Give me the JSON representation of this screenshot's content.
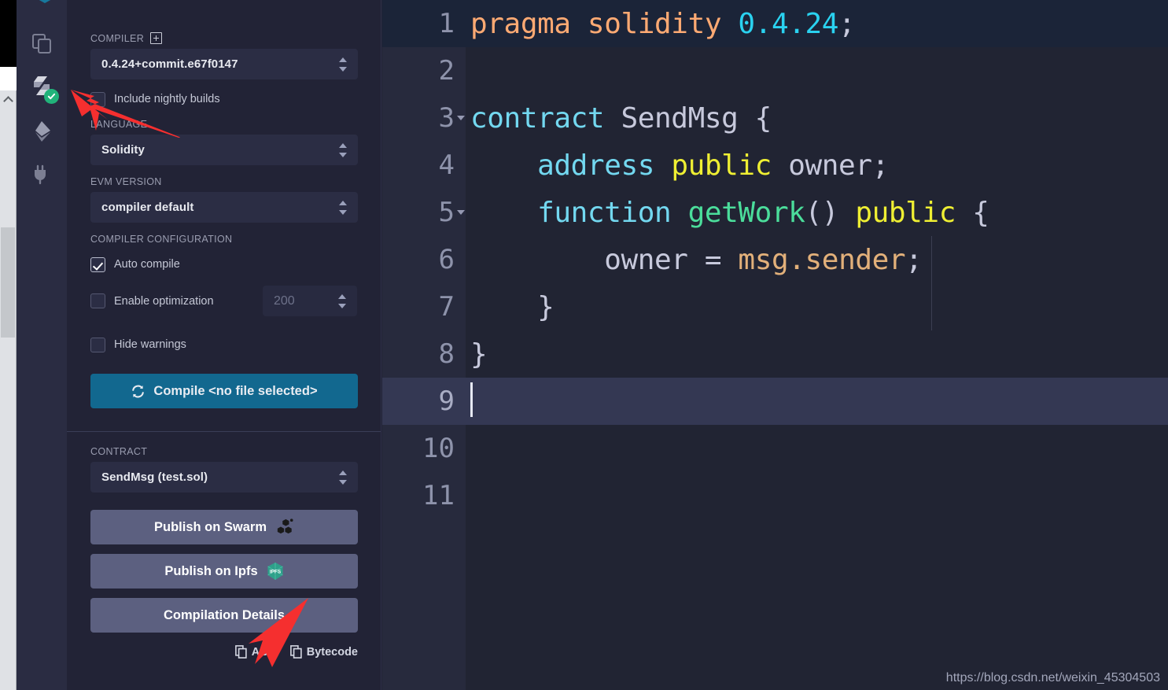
{
  "colors": {
    "panel_bg": "#222336",
    "rail_bg": "#2a2c42",
    "editor_bg": "#212433",
    "gutter_bg": "#272a3d",
    "accent_compile": "#12688f",
    "publish_btn": "#5c6080",
    "badge_green": "#21b37a",
    "annotation_red": "#f52f2f",
    "active_line": "#343853"
  },
  "rail": {
    "logo_name": "remix-logo",
    "items": [
      {
        "name": "file-explorers-icon",
        "label": "File explorers"
      },
      {
        "name": "solidity-compiler-icon",
        "label": "Solidity compiler",
        "badge": "check"
      },
      {
        "name": "deploy-run-icon",
        "label": "Deploy and run transactions"
      },
      {
        "name": "plugin-manager-icon",
        "label": "Plugin manager"
      }
    ]
  },
  "panel": {
    "compiler_label": "COMPILER",
    "compiler_add_icon": "plus-box-icon",
    "compiler_version": "0.4.24+commit.e67f0147",
    "nightly_checkbox": {
      "label": "Include nightly builds",
      "checked": false
    },
    "language_label": "LANGUAGE",
    "language_value": "Solidity",
    "evm_label": "EVM VERSION",
    "evm_value": "compiler default",
    "config_label": "COMPILER CONFIGURATION",
    "auto_compile": {
      "label": "Auto compile",
      "checked": true
    },
    "enable_optimization": {
      "label": "Enable optimization",
      "checked": false
    },
    "optimization_runs_placeholder": "200",
    "hide_warnings": {
      "label": "Hide warnings",
      "checked": false
    },
    "compile_button": {
      "label": "Compile <no file selected>",
      "icon": "sync-icon"
    },
    "contract_label": "CONTRACT",
    "contract_value": "SendMsg (test.sol)",
    "publish_swarm": {
      "label": "Publish on Swarm",
      "icon": "swarm-icon"
    },
    "publish_ipfs": {
      "label": "Publish on Ipfs",
      "icon": "ipfs-icon"
    },
    "compilation_details": {
      "label": "Compilation Details"
    },
    "copy_abi": {
      "label": "ABI",
      "icon": "copy-icon"
    },
    "copy_bytecode": {
      "label": "Bytecode",
      "icon": "copy-icon"
    }
  },
  "editor": {
    "active_line": 9,
    "lines": [
      {
        "n": "1",
        "highlight": "top",
        "fold": false,
        "tokens": [
          {
            "t": "pragma ",
            "c": "kw"
          },
          {
            "t": "solidity ",
            "c": "kw"
          },
          {
            "t": "0.4.24",
            "c": "num"
          },
          {
            "t": ";",
            "c": "punct"
          }
        ]
      },
      {
        "n": "2",
        "highlight": "none",
        "fold": false,
        "tokens": []
      },
      {
        "n": "3",
        "highlight": "none",
        "fold": true,
        "tokens": [
          {
            "t": "contract ",
            "c": "decl"
          },
          {
            "t": "SendMsg ",
            "c": "name"
          },
          {
            "t": "{",
            "c": "punct"
          }
        ]
      },
      {
        "n": "4",
        "highlight": "none",
        "fold": false,
        "tokens": [
          {
            "t": "    ",
            "c": "plain"
          },
          {
            "t": "address ",
            "c": "decl"
          },
          {
            "t": "public ",
            "c": "mod"
          },
          {
            "t": "owner",
            "c": "var"
          },
          {
            "t": ";",
            "c": "punct"
          }
        ]
      },
      {
        "n": "5",
        "highlight": "none",
        "fold": true,
        "tokens": [
          {
            "t": "    ",
            "c": "plain"
          },
          {
            "t": "function ",
            "c": "decl"
          },
          {
            "t": "getWork",
            "c": "fn"
          },
          {
            "t": "() ",
            "c": "punct"
          },
          {
            "t": "public ",
            "c": "mod"
          },
          {
            "t": "{",
            "c": "punct"
          }
        ]
      },
      {
        "n": "6",
        "highlight": "none",
        "fold": false,
        "tokens": [
          {
            "t": "        ",
            "c": "plain"
          },
          {
            "t": "owner ",
            "c": "var"
          },
          {
            "t": "= ",
            "c": "punct"
          },
          {
            "t": "msg.sender",
            "c": "global"
          },
          {
            "t": ";",
            "c": "punct"
          }
        ]
      },
      {
        "n": "7",
        "highlight": "none",
        "fold": false,
        "tokens": [
          {
            "t": "    ",
            "c": "plain"
          },
          {
            "t": "}",
            "c": "punct"
          }
        ]
      },
      {
        "n": "8",
        "highlight": "none",
        "fold": false,
        "tokens": [
          {
            "t": "}",
            "c": "punct"
          }
        ]
      },
      {
        "n": "9",
        "highlight": "active",
        "fold": false,
        "cursor": true,
        "tokens": []
      },
      {
        "n": "10",
        "highlight": "none",
        "fold": false,
        "tokens": []
      },
      {
        "n": "11",
        "highlight": "none",
        "fold": false,
        "tokens": []
      }
    ]
  },
  "watermark": "https://blog.csdn.net/weixin_45304503"
}
